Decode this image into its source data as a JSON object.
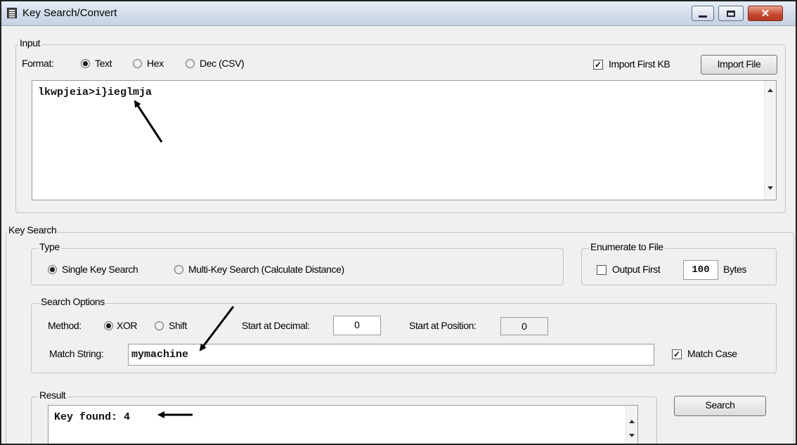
{
  "window": {
    "title": "Key Search/Convert"
  },
  "input": {
    "legend": "Input",
    "format_label": "Format:",
    "format_options": [
      "Text",
      "Hex",
      "Dec (CSV)"
    ],
    "format_selected": "Text",
    "import_first_kb_label": "Import First KB",
    "import_first_kb_checked": true,
    "import_file_button": "Import File",
    "text_value": "lkwpjeia>i}ieglmja"
  },
  "key_search": {
    "legend": "Key Search",
    "type": {
      "legend": "Type",
      "options": [
        "Single Key Search",
        "Multi-Key Search (Calculate Distance)"
      ],
      "selected": "Single Key Search"
    },
    "enumerate": {
      "legend": "Enumerate to File",
      "output_first_label": "Output First",
      "output_first_checked": false,
      "bytes_value": "100",
      "bytes_label": "Bytes"
    },
    "search_options": {
      "legend": "Search Options",
      "method_label": "Method:",
      "methods": [
        "XOR",
        "Shift"
      ],
      "method_selected": "XOR",
      "start_decimal_label": "Start at Decimal:",
      "start_decimal_value": "0",
      "start_position_label": "Start at Position:",
      "start_position_value": "0",
      "match_string_label": "Match String:",
      "match_string_value": "mymachine",
      "match_case_label": "Match Case",
      "match_case_checked": true
    },
    "result": {
      "legend": "Result",
      "value": "Key found: 4"
    },
    "search_button": "Search"
  }
}
